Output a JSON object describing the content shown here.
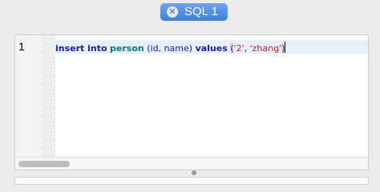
{
  "tab": {
    "label": "SQL 1",
    "close_glyph": "✕",
    "close_icon": "close-circle-icon",
    "color": "#4a8be8"
  },
  "editor": {
    "line_number": "1",
    "tokens": {
      "kw1": "insert into",
      "table": "person",
      "cols": "(id, name)",
      "kw2": "values",
      "open": "(",
      "val1": "'2'",
      "comma": ", ",
      "val2": "'zhang'",
      "close": ")"
    },
    "colors": {
      "keyword": "#1d21a0",
      "identifier": "#117a7e",
      "string": "#c1271f",
      "current_line": "#e9eefb"
    }
  }
}
